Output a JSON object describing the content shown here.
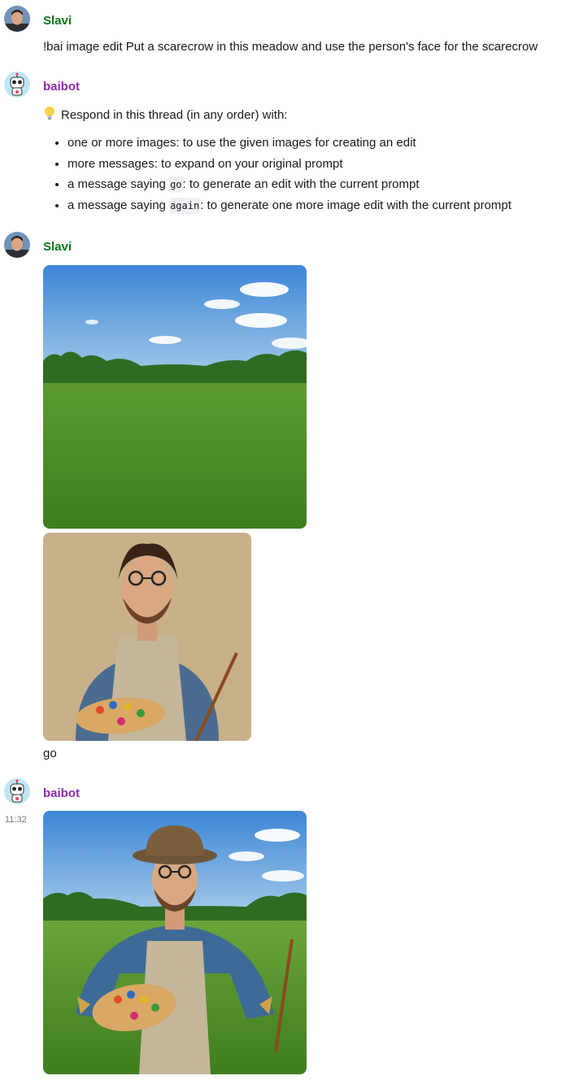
{
  "messages": [
    {
      "sender": "Slavi",
      "text": "!bai image edit Put a scarecrow in this meadow and use the person's face for the scarecrow"
    },
    {
      "sender": "baibot",
      "intro": "Respond in this thread (in any order) with:",
      "intro_icon": "lightbulb-icon",
      "bullets": [
        {
          "text": "one or more images: to use the given images for creating an edit"
        },
        {
          "text": "more messages: to expand on your original prompt"
        },
        {
          "pre": "a message saying ",
          "code": "go",
          "post": ": to generate an edit with the current prompt"
        },
        {
          "pre": "a message saying ",
          "code": "again",
          "post": ": to generate one more image edit with the current prompt"
        }
      ]
    },
    {
      "sender": "Slavi",
      "images": [
        "meadow-image",
        "painter-portrait-image"
      ],
      "text": "go"
    },
    {
      "sender": "baibot",
      "timestamp": "11:32",
      "images": [
        "scarecrow-edit-image"
      ]
    }
  ],
  "colors": {
    "human_name": "#0b7a1a",
    "bot_name": "#8a2aa8",
    "code_bg": "#eef0f3",
    "timestamp": "#737d8c"
  }
}
